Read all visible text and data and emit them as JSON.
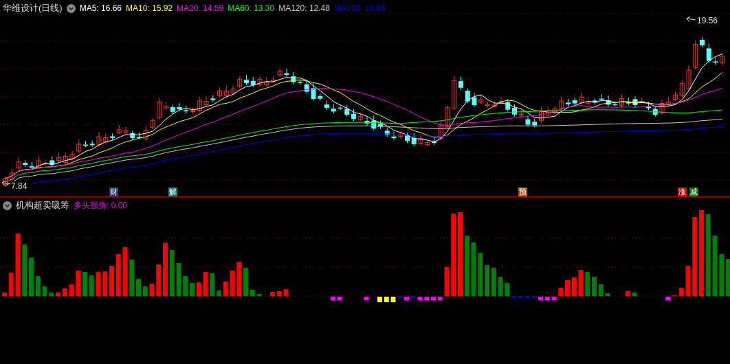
{
  "main_chart": {
    "title": "华维设计(日线)",
    "indicators": [
      {
        "label": "MA5: 16.66",
        "color": "#ffffff"
      },
      {
        "label": "MA10: 15.92",
        "color": "#ffff00"
      },
      {
        "label": "MA20: 14.59",
        "color": "#ff00ff"
      },
      {
        "label": "MA60: 13.30",
        "color": "#00ff00"
      },
      {
        "label": "MA120: 12.48",
        "color": "#c8c8c8"
      },
      {
        "label": "MA250: 10.94",
        "color": "#0000ff"
      }
    ],
    "high_label": "19.56",
    "low_label": "7.84",
    "markers": [
      {
        "text": "财",
        "color": "#1a3f8f"
      },
      {
        "text": "解",
        "color": "#008080"
      },
      {
        "text": "预",
        "color": "#b04a10"
      },
      {
        "text": "涨",
        "color": "#cc0000"
      },
      {
        "text": "减",
        "color": "#008000"
      }
    ]
  },
  "sub_chart": {
    "title": "机构超卖吸筹",
    "indicators": [
      {
        "label": "多头强势: 0.00"
      }
    ]
  }
}
